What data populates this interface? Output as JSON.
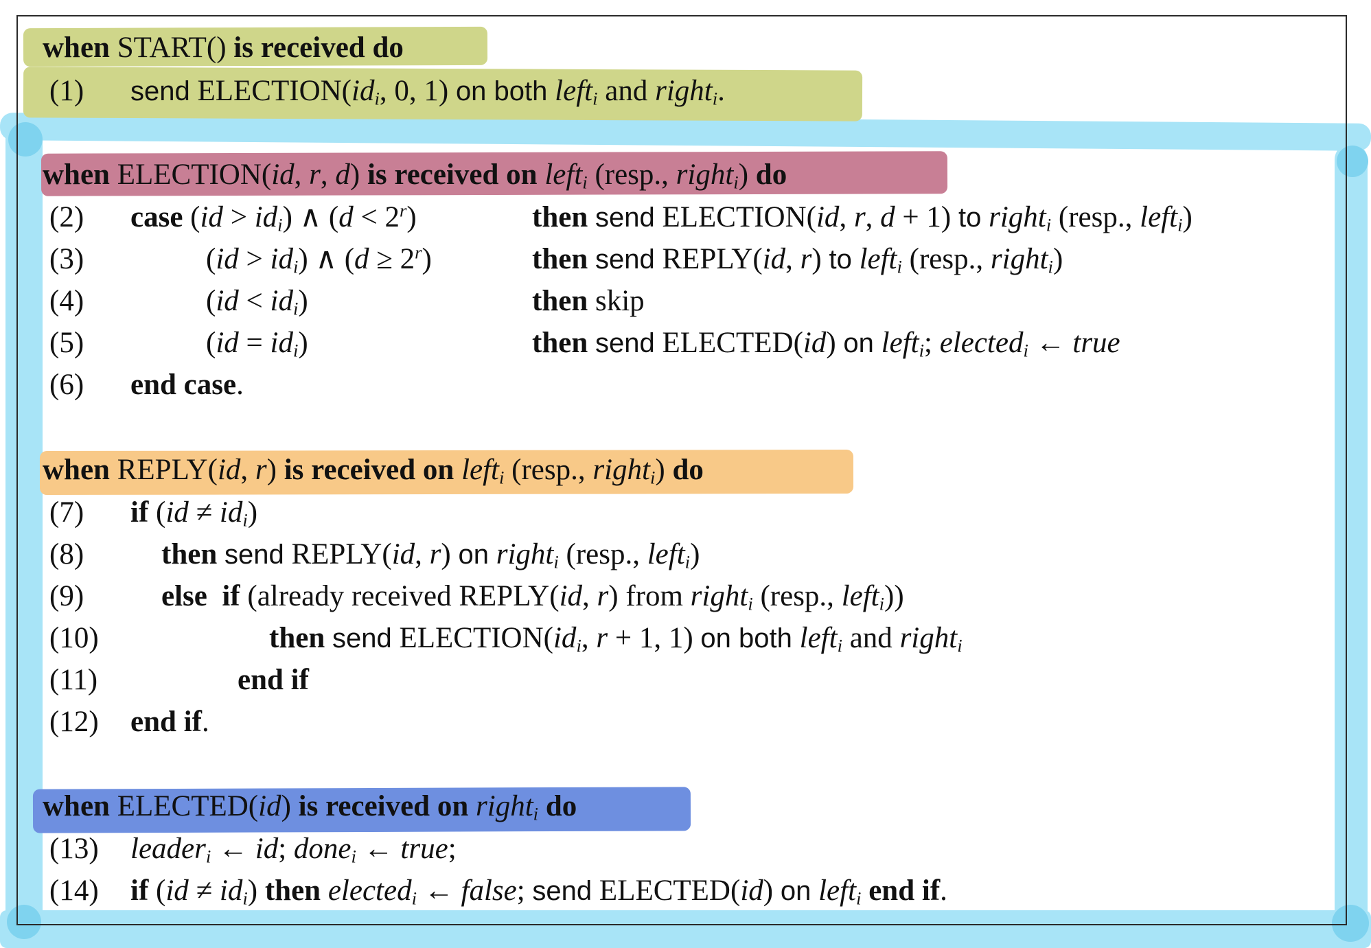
{
  "handlers": [
    {
      "id": "start",
      "head": {
        "when": "when",
        "msg": "START",
        "args": "()",
        "rest": "is received do"
      },
      "highlight": "#cfd68a"
    },
    {
      "id": "election",
      "head": {
        "when": "when",
        "msg": "ELECTION",
        "rest": "is received on",
        "resp": "(resp.,",
        "do": "do"
      },
      "highlight": "#c87f95"
    },
    {
      "id": "reply",
      "head": {
        "when": "when",
        "msg": "REPLY",
        "rest": "is received on",
        "resp": "(resp.,",
        "do": "do"
      },
      "highlight": "#f8c988"
    },
    {
      "id": "elected",
      "head": {
        "when": "when",
        "msg": "ELECTED",
        "rest": "is received on",
        "do": "do"
      },
      "highlight": "#6e8fe0"
    }
  ],
  "line_numbers": [
    "(1)",
    "(2)",
    "(3)",
    "(4)",
    "(5)",
    "(6)",
    "(7)",
    "(8)",
    "(9)",
    "(10)",
    "(11)",
    "(12)",
    "(13)",
    "(14)"
  ],
  "words": {
    "send": "send",
    "on_both": "on both",
    "and": "and",
    "case": "case",
    "then": "then",
    "to": "to",
    "skip": "skip",
    "on": "on",
    "end_case": "end case",
    "if": "if",
    "else": "else",
    "already_received": "(already received",
    "from": "from",
    "end_if": "end if"
  },
  "msgs": {
    "election": "ELECTION",
    "reply": "REPLY",
    "elected": "ELECTED"
  },
  "vars": {
    "id": "id",
    "r": "r",
    "d": "d",
    "left": "left",
    "right": "right",
    "sub_i": "i",
    "elected": "elected",
    "leader": "leader",
    "done": "done",
    "true": "true",
    "false": "false",
    "resp": "(resp.,"
  },
  "colors": {
    "blue_marker": "#a8e4f7",
    "frame": "#2a2a2a"
  }
}
